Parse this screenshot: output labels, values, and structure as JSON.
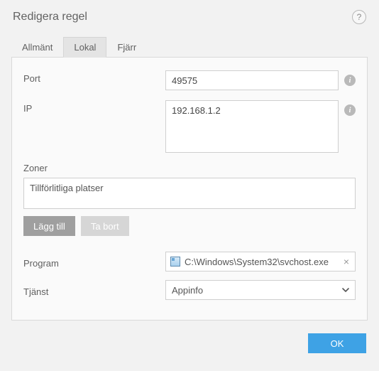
{
  "window": {
    "title": "Redigera regel"
  },
  "tabs": {
    "general": "Allmänt",
    "local": "Lokal",
    "remote": "Fjärr",
    "active": "local"
  },
  "form": {
    "port_label": "Port",
    "port_value": "49575",
    "ip_label": "IP",
    "ip_value": "192.168.1.2",
    "zones_label": "Zoner",
    "zones_items": [
      "Tillförlitliga platser"
    ],
    "add_label": "Lägg till",
    "remove_label": "Ta bort",
    "program_label": "Program",
    "program_path": "C:\\Windows\\System32\\svchost.exe",
    "service_label": "Tjänst",
    "service_value": "Appinfo",
    "service_options": [
      "Appinfo"
    ]
  },
  "footer": {
    "ok_label": "OK"
  }
}
